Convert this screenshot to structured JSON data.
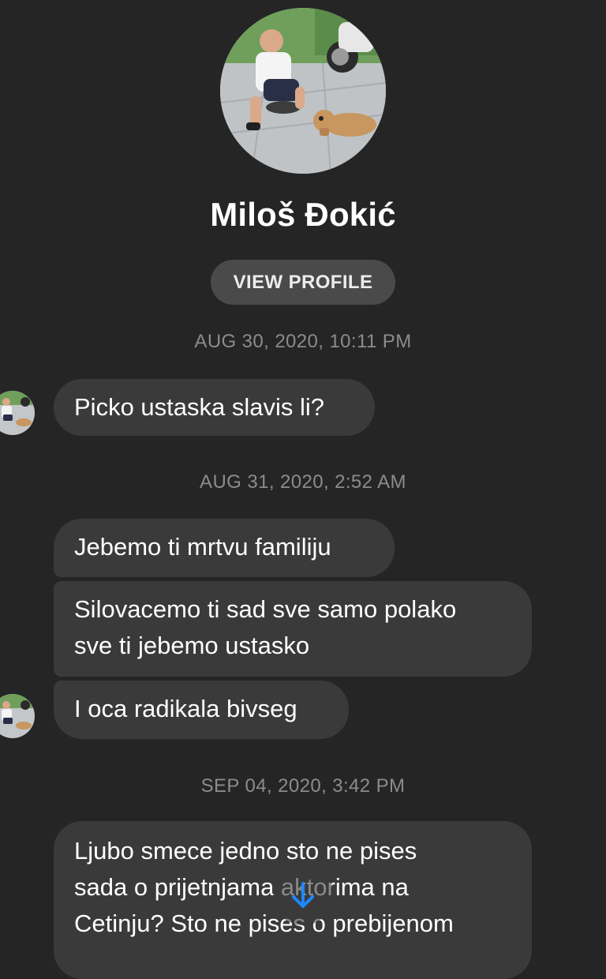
{
  "contact": {
    "name": "Miloš Đokić",
    "view_profile_label": "VIEW PROFILE"
  },
  "messages": {
    "group1": {
      "timestamp": "AUG 30, 2020, 10:11 PM",
      "m1": "Picko ustaska slavis li?"
    },
    "group2": {
      "timestamp": "AUG 31, 2020, 2:52 AM",
      "m1": "Jebemo ti mrtvu familiju",
      "m2_line1": "Silovacemo ti sad sve samo polako",
      "m2_line2": "sve ti jebemo ustasko",
      "m3": "I oca radikala bivseg"
    },
    "group3": {
      "timestamp": "SEP 04, 2020, 3:42 PM",
      "m1_line1": "Ljubo smece jedno sto ne pises",
      "m1_line2": "sada o prijetnjama aktorima na",
      "m1_line3": "Cetinju? Sto ne pises o prebijenom"
    }
  },
  "icons": {
    "scroll": "arrow-down-icon"
  },
  "colors": {
    "background": "#252525",
    "bubble": "#3a3a3a",
    "timestamp": "#8c8c8c",
    "button": "#4a4a4a",
    "accent": "#1e88ff"
  }
}
